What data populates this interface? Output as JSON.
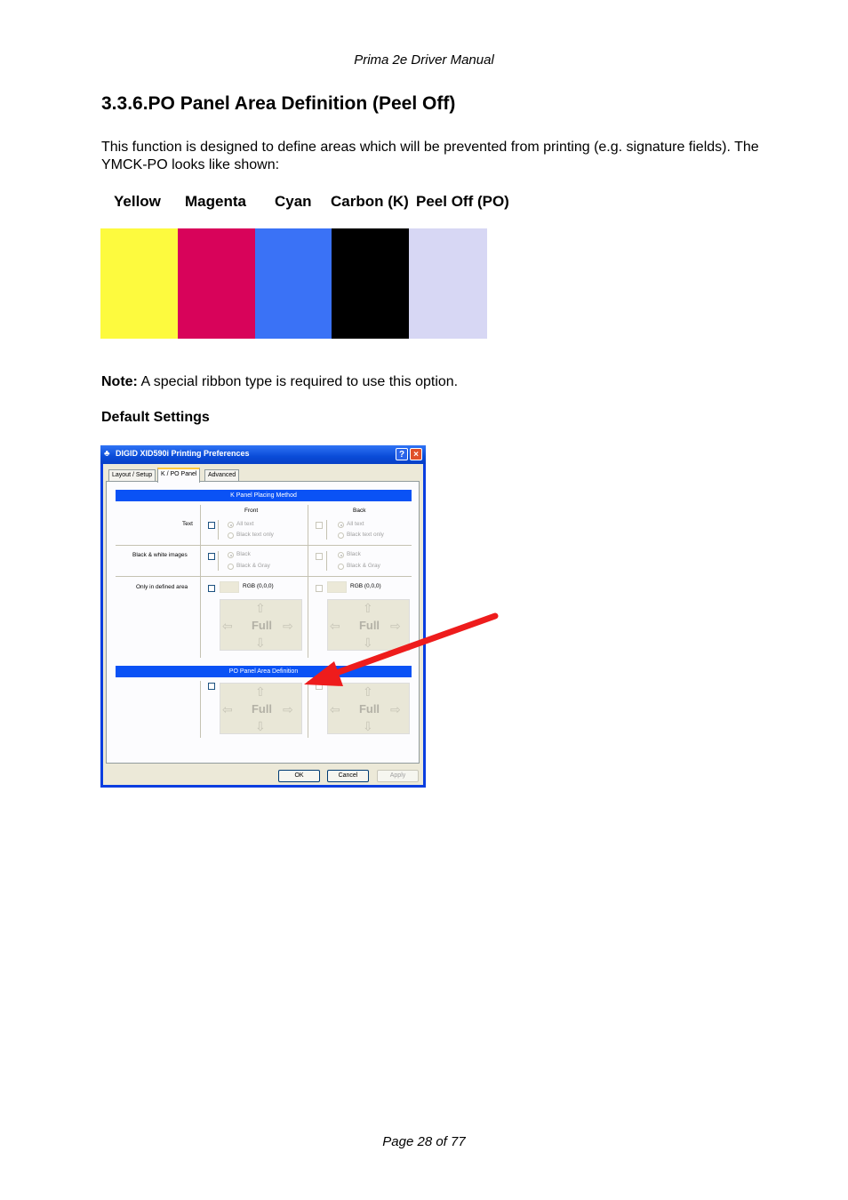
{
  "header": "Prima 2e Driver Manual",
  "section_title": "3.3.6.PO Panel Area Definition (Peel Off)",
  "intro": "This function is designed to define areas which will be prevented from printing (e.g. signature fields). The YMCK-PO looks like shown:",
  "ribbon": {
    "panels": [
      {
        "label": "Yellow",
        "color": "#fdfa3e"
      },
      {
        "label": "Magenta",
        "color": "#d8035a"
      },
      {
        "label": "Cyan",
        "color": "#3a72f6"
      },
      {
        "label": "Carbon (K)",
        "color": "#000000"
      },
      {
        "label": "Peel Off (PO)",
        "color": "#d7d7f4"
      }
    ]
  },
  "note": {
    "label": "Note:",
    "text": " A special ribbon type is required to use this option."
  },
  "default_settings": "Default Settings",
  "dialog": {
    "title": "DIGID XID590i Printing Preferences",
    "help_label": "?",
    "close_label": "×",
    "tabs": [
      "Layout / Setup",
      "K / PO Panel",
      "Advanced"
    ],
    "k_section_title": "K Panel Placing Method",
    "front_label": "Front",
    "back_label": "Back",
    "rows": {
      "text": "Text",
      "bw_images": "Black & white images",
      "defined_area": "Only in defined area"
    },
    "options": {
      "all_text": "All text",
      "black_text_only": "Black text only",
      "black": "Black",
      "black_gray": "Black & Gray",
      "rgb": "RGB (0,0,0)",
      "full": "Full"
    },
    "po_section_title": "PO Panel Area Definition",
    "buttons": {
      "ok": "OK",
      "cancel": "Cancel",
      "apply": "Apply"
    }
  },
  "footer": "Page 28 of 77"
}
